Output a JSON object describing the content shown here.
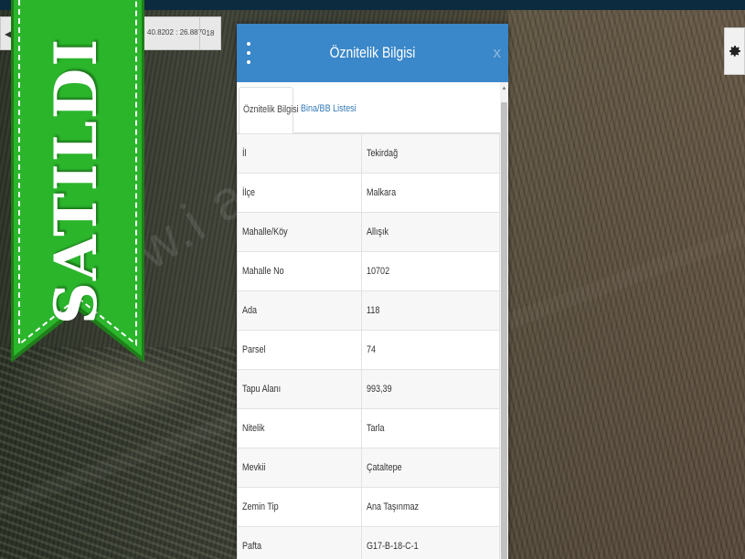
{
  "coords": {
    "text": "40.8202 : 26.8870",
    "btn": "18"
  },
  "ribbon": {
    "text": "SATILDI",
    "color": "#2bb52b"
  },
  "watermark": {
    "text": "www.i                a.net.tr"
  },
  "panel": {
    "title": "Öznitelik Bilgisi",
    "close": "x",
    "tabs": [
      {
        "label": "Öznitelik Bilgisi"
      },
      {
        "label": "Bina/BB Listesi"
      }
    ],
    "rows": [
      {
        "key": "İl",
        "value": "Tekirdağ"
      },
      {
        "key": "İlçe",
        "value": "Malkara"
      },
      {
        "key": "Mahalle/Köy",
        "value": "Allışık"
      },
      {
        "key": "Mahalle No",
        "value": "10702"
      },
      {
        "key": "Ada",
        "value": "118"
      },
      {
        "key": "Parsel",
        "value": "74"
      },
      {
        "key": "Tapu Alanı",
        "value": "993,39"
      },
      {
        "key": "Nitelik",
        "value": "Tarla"
      },
      {
        "key": "Mevkii",
        "value": "Çataltepe"
      },
      {
        "key": "Zemin Tip",
        "value": "Ana Taşınmaz"
      },
      {
        "key": "Pafta",
        "value": "G17-B-18-C-1"
      }
    ]
  },
  "colors": {
    "header": "#3a87c9",
    "link": "#337ab7"
  },
  "icons": {
    "menu": "kebab-menu-icon",
    "gear": "gear-icon",
    "arrow": "arrow-left-icon"
  }
}
